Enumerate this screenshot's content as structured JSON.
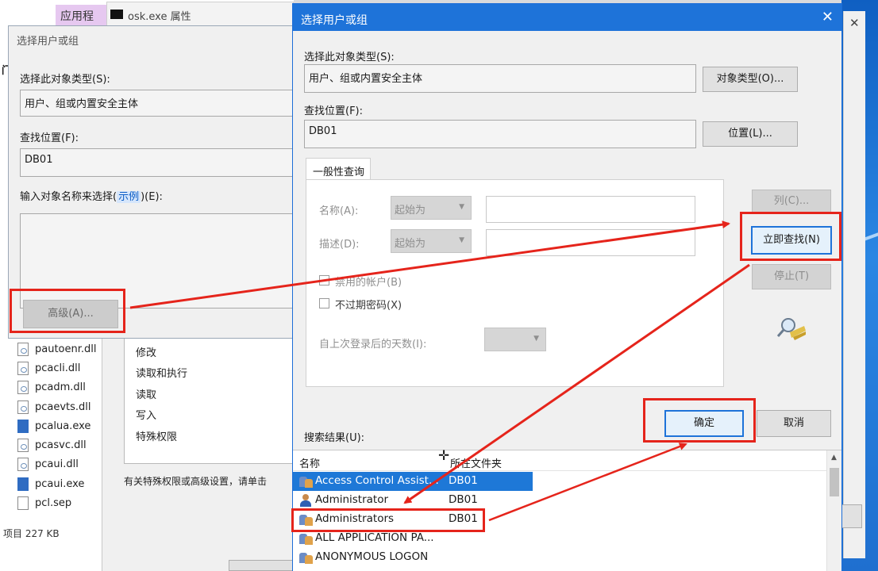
{
  "background": {
    "tab_label": "应用程序",
    "osk_title": "osk.exe 属性",
    "side_marker": "门",
    "files": [
      {
        "name": "pautoenr.dll",
        "type": "dll"
      },
      {
        "name": "pcacli.dll",
        "type": "dll"
      },
      {
        "name": "pcadm.dll",
        "type": "dll"
      },
      {
        "name": "pcaevts.dll",
        "type": "dll"
      },
      {
        "name": "pcalua.exe",
        "type": "exe"
      },
      {
        "name": "pcasvc.dll",
        "type": "dll"
      },
      {
        "name": "pcaui.dll",
        "type": "dll"
      },
      {
        "name": "pcaui.exe",
        "type": "exe"
      },
      {
        "name": "pcl.sep",
        "type": "file"
      }
    ],
    "status_bar": "项目 227 KB",
    "permissions": [
      "修改",
      "读取和执行",
      "读取",
      "写入",
      "特殊权限"
    ],
    "permissions_note": "有关特殊权限或高级设置，请单击"
  },
  "left_dialog": {
    "title": "选择用户或组",
    "object_type_label": "选择此对象类型(S):",
    "object_type_value": "用户、组或内置安全主体",
    "location_label": "查找位置(F):",
    "location_value": "DB01",
    "enter_names_label_pre": "输入对象名称来选择(",
    "enter_names_link": "示例",
    "enter_names_label_post": ")(E):",
    "advanced_button": "高级(A)..."
  },
  "main_dialog": {
    "title": "选择用户或组",
    "object_type_label": "选择此对象类型(S):",
    "object_type_value": "用户、组或内置安全主体",
    "object_types_button": "对象类型(O)...",
    "location_label": "查找位置(F):",
    "location_value": "DB01",
    "locations_button": "位置(L)...",
    "tab_label": "一般性查询",
    "name_label": "名称(A):",
    "name_mode": "起始为",
    "desc_label": "描述(D):",
    "desc_mode": "起始为",
    "disabled_accounts": "禁用的帐户(B)",
    "non_expiring": "不过期密码(X)",
    "days_since_logon": "自上次登录后的天数(I):",
    "columns_button": "列(C)...",
    "find_now_button": "立即查找(N)",
    "stop_button": "停止(T)",
    "ok_button": "确定",
    "cancel_button": "取消",
    "results_label": "搜索结果(U):",
    "results_columns": [
      "名称",
      "所在文件夹"
    ],
    "results": [
      {
        "name": "Access Control Assist...",
        "folder": "DB01",
        "icon": "group",
        "selected": true
      },
      {
        "name": "Administrator",
        "folder": "DB01",
        "icon": "user",
        "selected": false
      },
      {
        "name": "Administrators",
        "folder": "DB01",
        "icon": "group",
        "selected": false
      },
      {
        "name": "ALL APPLICATION PA...",
        "folder": "",
        "icon": "group",
        "selected": false
      },
      {
        "name": "ANONYMOUS LOGON",
        "folder": "",
        "icon": "group",
        "selected": false
      }
    ]
  },
  "colors": {
    "accent": "#1e73d9",
    "annotation_red": "#e5241b",
    "selection": "#1e78d7"
  }
}
